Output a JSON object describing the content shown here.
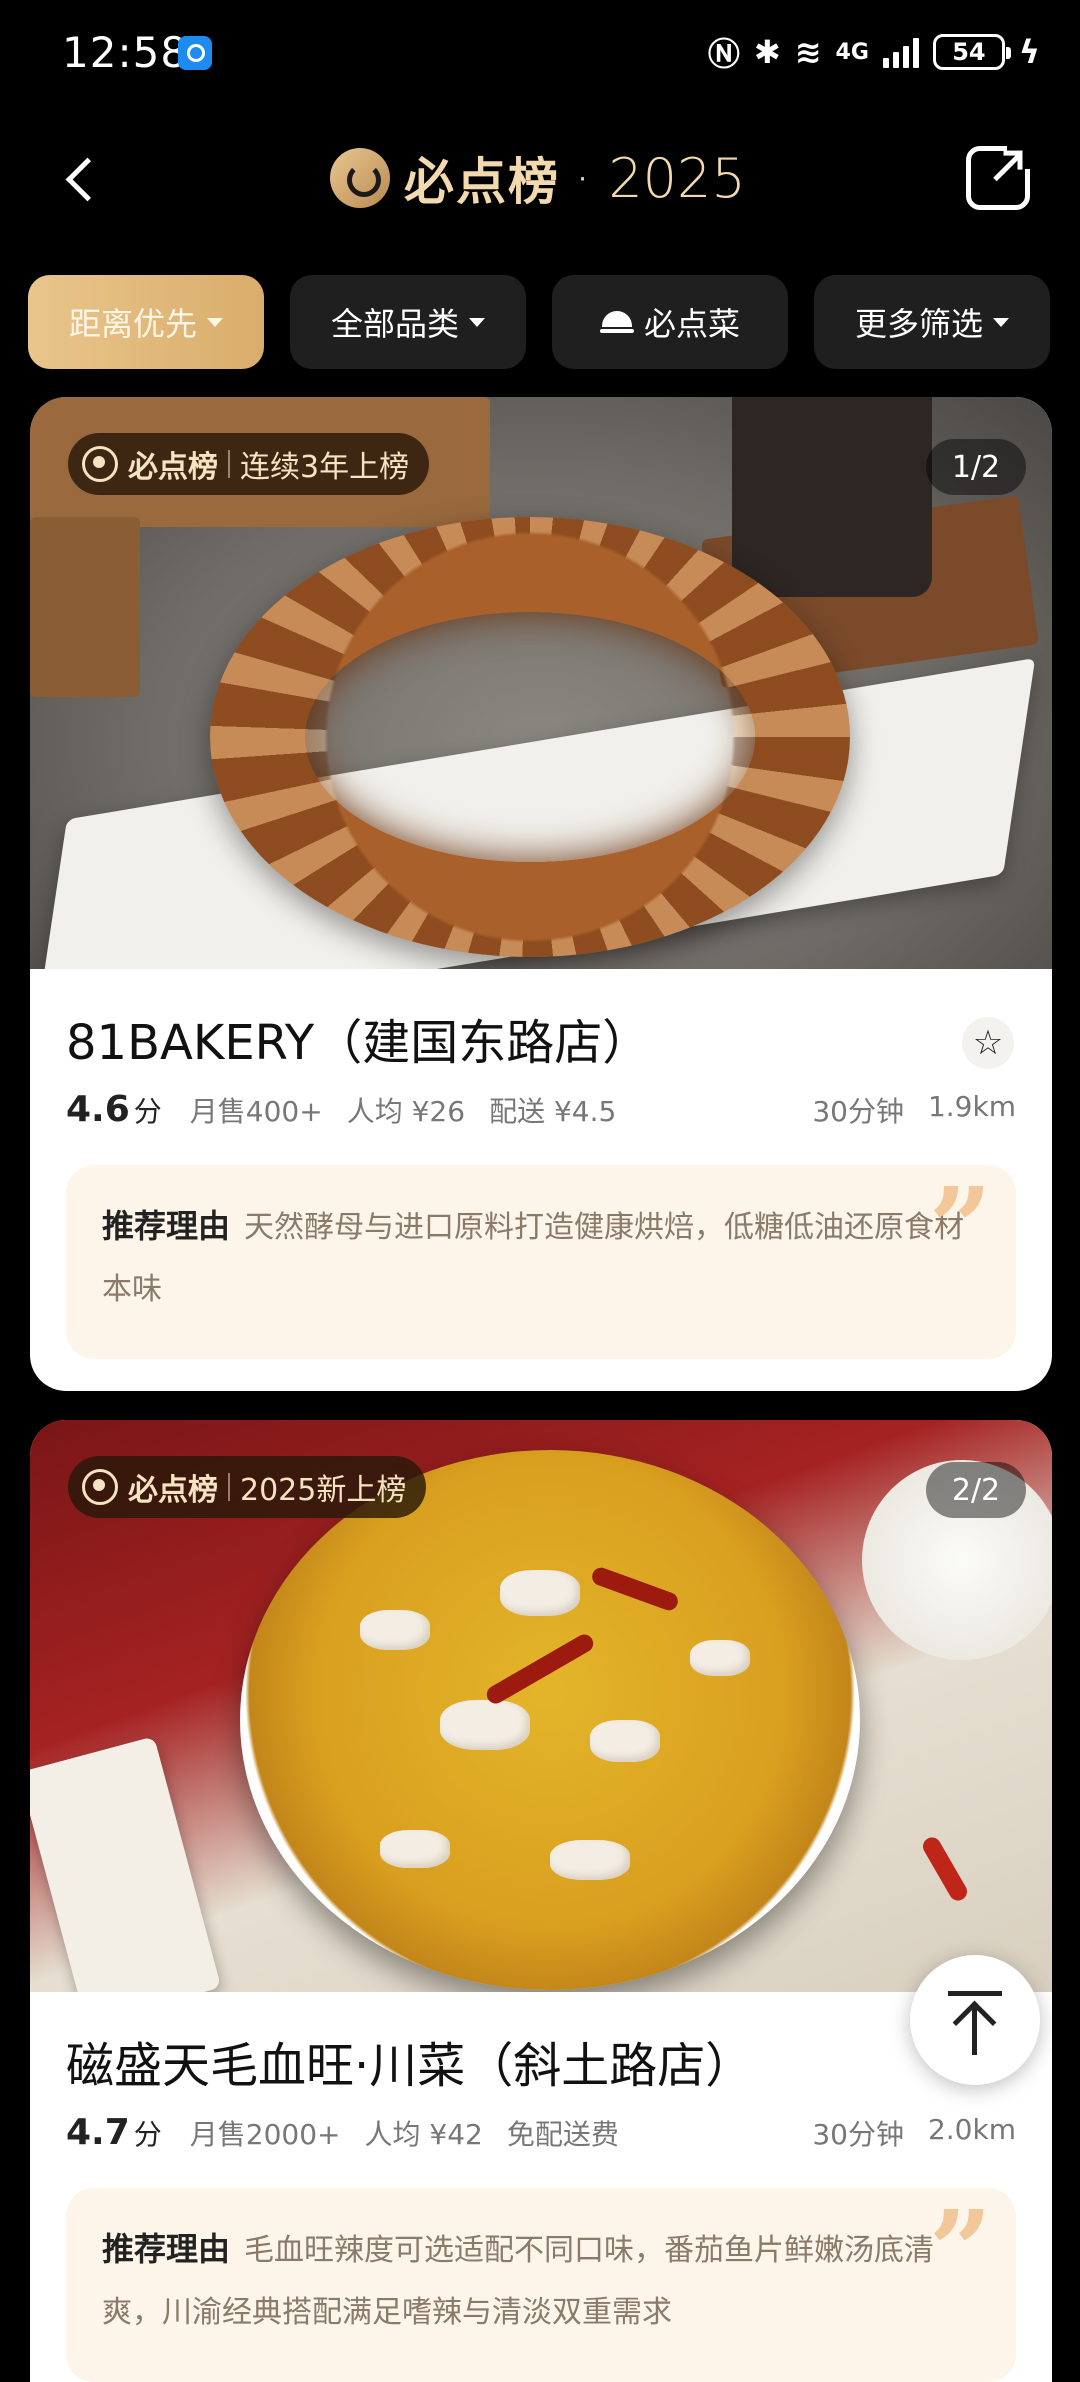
{
  "status_bar": {
    "time": "12:58",
    "network": "4G",
    "battery": "54"
  },
  "header": {
    "brand": "必点榜",
    "year_text": "· 2025"
  },
  "filters": [
    {
      "label": "距离优先",
      "active": true
    },
    {
      "label": "全部品类",
      "active": false
    },
    {
      "label": "必点菜",
      "active": false
    },
    {
      "label": "更多筛选",
      "active": false
    }
  ],
  "cards": [
    {
      "badge_brand": "必点榜",
      "badge_text": "连续3年上榜",
      "counter": "1/2",
      "name": "81BAKERY（建国东路店）",
      "rating": "4.6",
      "rating_unit": "分",
      "monthly_sales": "月售400+",
      "per_capita": "人均 ¥26",
      "delivery": "配送 ¥4.5",
      "time": "30分钟",
      "distance": "1.9km",
      "reason_label": "推荐理由",
      "reason_text": "天然酵母与进口原料打造健康烘焙，低糖低油还原食材本味"
    },
    {
      "badge_brand": "必点榜",
      "badge_text": "2025新上榜",
      "counter": "2/2",
      "name": "磁盛天毛血旺·川菜（斜土路店）",
      "rating": "4.7",
      "rating_unit": "分",
      "monthly_sales": "月售2000+",
      "per_capita": "人均 ¥42",
      "delivery": "免配送费",
      "time": "30分钟",
      "distance": "2.0km",
      "reason_label": "推荐理由",
      "reason_text": "毛血旺辣度可选适配不同口味，番茄鱼片鲜嫩汤底清爽，川渝经典搭配满足嗜辣与清淡双重需求"
    }
  ],
  "colors": {
    "accent_gold": "#e9c58c",
    "reason_bg": "#fdf4ea",
    "quote": "#f2c89a"
  }
}
